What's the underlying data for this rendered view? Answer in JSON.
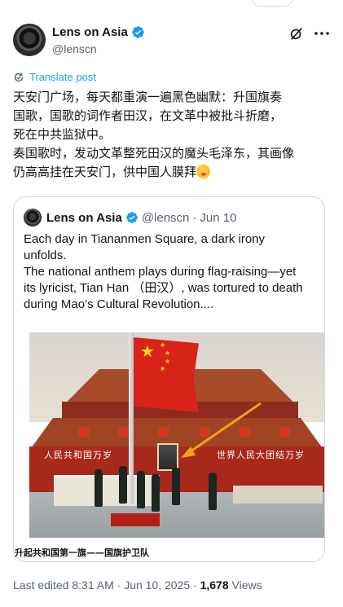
{
  "author": {
    "display_name": "Lens on Asia",
    "handle": "@lenscn"
  },
  "translate_label": "Translate post",
  "post_lines": [
    "天安门广场，每天都重演一遍黑色幽默：升国旗奏",
    "国歌，国歌的词作者田汉，在文革中被批斗折磨，",
    "死在中共监狱中。",
    "奏国歌时，发动文革整死田汉的魔头毛泽东，其画像",
    "仍高高挂在天安门，供中国人膜拜"
  ],
  "quote": {
    "display_name": "Lens on Asia",
    "handle": "@lenscn",
    "separator": "·",
    "date": "Jun 10",
    "lines": [
      "Each day in Tiananmen Square, a dark irony",
      "unfolds.",
      "The national anthem plays during flag-raising—yet",
      "its lyricist, Tian Han （田汉）, was tortured to death",
      "during Mao’s Cultural Revolution...."
    ],
    "image": {
      "slogan_left": "人民共和国万岁",
      "slogan_right": "世界人民大团结万岁",
      "caption": "升起共和国第一旗——国旗护卫队"
    }
  },
  "footer": {
    "edited": "Last edited 8:31 AM · Jun 10, 2025 · ",
    "views_count": "1,678",
    "views_label": " Views"
  },
  "colors": {
    "verified": "#1d9bf0",
    "link": "#1d9bf0",
    "muted": "#536471",
    "arrow": "#f2a21b"
  },
  "icons": [
    "verified-badge-icon",
    "grok-icon",
    "more-icon",
    "translate-icon",
    "tongue-emoji-icon"
  ]
}
